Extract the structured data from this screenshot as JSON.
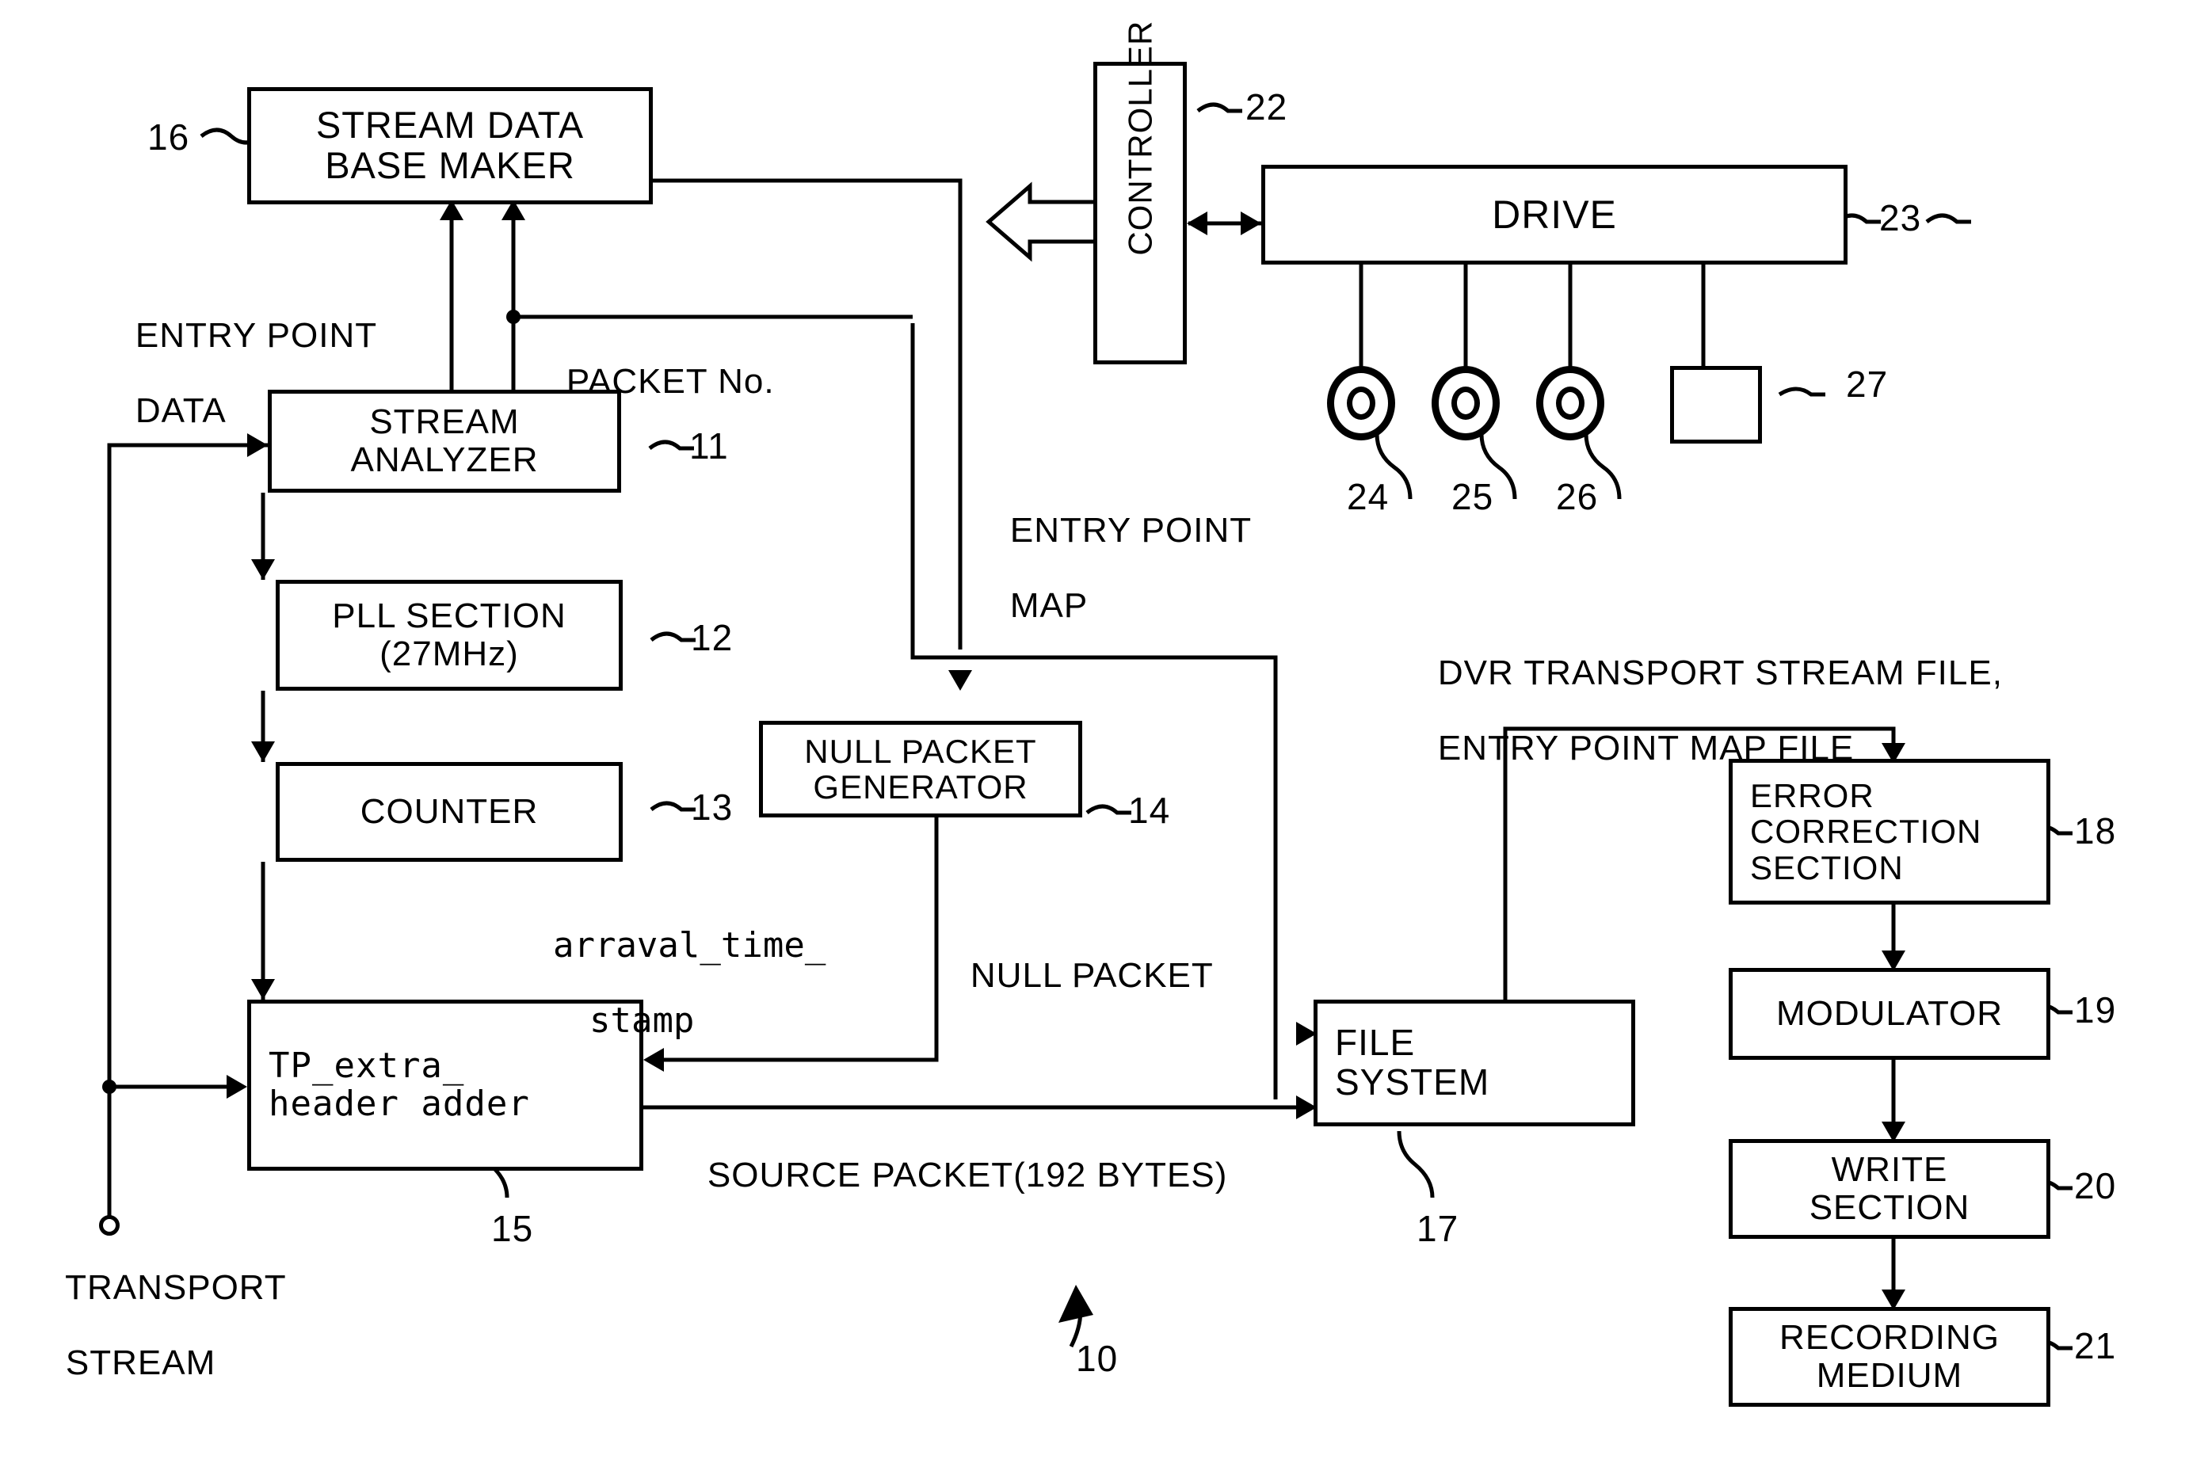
{
  "figure": {
    "ref_main": "10"
  },
  "blocks": {
    "stream_data_base_maker": {
      "line1": "STREAM DATA",
      "line2": "BASE MAKER",
      "ref": "16"
    },
    "stream_analyzer": {
      "line1": "STREAM",
      "line2": "ANALYZER",
      "ref": "11"
    },
    "pll_section": {
      "line1": "PLL SECTION",
      "line2": "(27MHz)",
      "ref": "12"
    },
    "counter": {
      "line1": "COUNTER",
      "ref": "13"
    },
    "null_packet_generator": {
      "line1": "NULL PACKET",
      "line2": "GENERATOR",
      "ref": "14"
    },
    "tp_extra_header_adder": {
      "line1": "TP_extra_",
      "line2": "header adder",
      "ref": "15"
    },
    "file_system": {
      "line1": "FILE",
      "line2": "SYSTEM",
      "ref": "17"
    },
    "controller": {
      "line1": "CONTROLLER",
      "ref": "22"
    },
    "drive": {
      "line1": "DRIVE",
      "ref": "23"
    },
    "error_correction": {
      "line1": "ERROR",
      "line2": "CORRECTION",
      "line3": "SECTION",
      "ref": "18"
    },
    "modulator": {
      "line1": "MODULATOR",
      "ref": "19"
    },
    "write_section": {
      "line1": "WRITE",
      "line2": "SECTION",
      "ref": "20"
    },
    "recording_medium": {
      "line1": "RECORDING",
      "line2": "MEDIUM",
      "ref": "21"
    }
  },
  "media": {
    "disc_a_ref": "24",
    "disc_b_ref": "25",
    "disc_c_ref": "26",
    "cartridge_ref": "27"
  },
  "labels": {
    "entry_point_data": {
      "line1": "ENTRY POINT",
      "line2": "DATA"
    },
    "packet_no": {
      "line1": "PACKET No."
    },
    "entry_point_map": {
      "line1": "ENTRY POINT",
      "line2": "MAP"
    },
    "arraval_time_stamp": {
      "line1": "arraval_time_",
      "line2": "stamp"
    },
    "null_packet": {
      "line1": "NULL PACKET"
    },
    "source_packet": {
      "line1": "SOURCE PACKET(192 BYTES)"
    },
    "transport_stream": {
      "line1": "TRANSPORT",
      "line2": "STREAM"
    },
    "dvr_files": {
      "line1": "DVR TRANSPORT STREAM FILE,",
      "line2": "ENTRY POINT MAP FILE"
    }
  }
}
